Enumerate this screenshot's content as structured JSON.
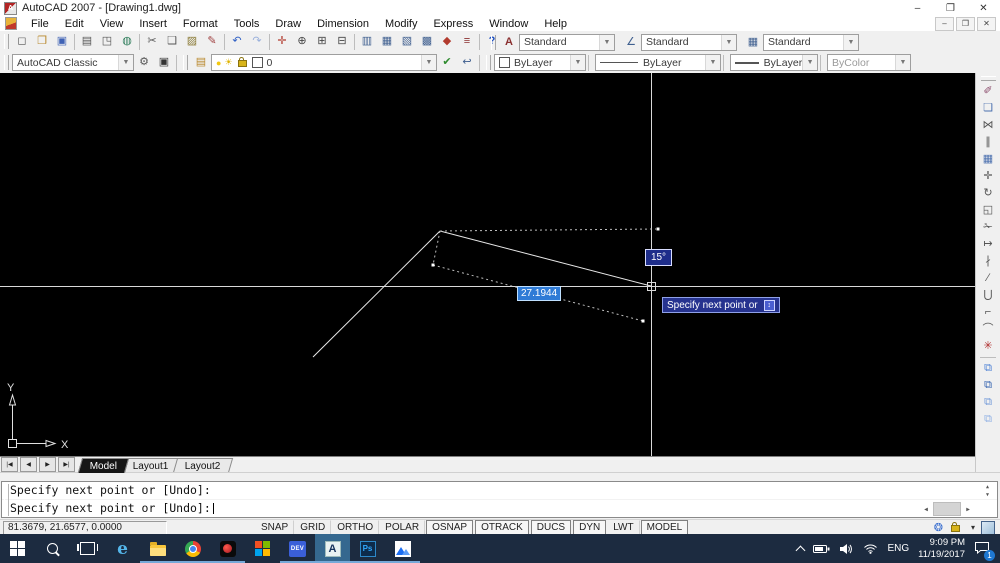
{
  "colors": {
    "taskbar_bg": "#1c2b40",
    "taskbar_active": "#35688f",
    "open_underline": "#76a9d8",
    "dyn_box_bg": "#1e2d8a",
    "selection_blue": "#2f7bd6",
    "canvas_bg": "#000000"
  },
  "window": {
    "title": "AutoCAD 2007 - [Drawing1.dwg]",
    "minimize_glyph": "–",
    "restore_glyph": "❐",
    "close_glyph": "✕"
  },
  "menubar": {
    "items": [
      {
        "n": "menu-file",
        "label": "File"
      },
      {
        "n": "menu-edit",
        "label": "Edit"
      },
      {
        "n": "menu-view",
        "label": "View"
      },
      {
        "n": "menu-insert",
        "label": "Insert"
      },
      {
        "n": "menu-format",
        "label": "Format"
      },
      {
        "n": "menu-tools",
        "label": "Tools"
      },
      {
        "n": "menu-draw",
        "label": "Draw"
      },
      {
        "n": "menu-dimension",
        "label": "Dimension"
      },
      {
        "n": "menu-modify",
        "label": "Modify"
      },
      {
        "n": "menu-express",
        "label": "Express"
      },
      {
        "n": "menu-window",
        "label": "Window"
      },
      {
        "n": "menu-help",
        "label": "Help"
      }
    ]
  },
  "toolbar1": {
    "file_group": [
      {
        "n": "qnew-button",
        "g": "◻",
        "c": "#555555"
      },
      {
        "n": "open-button",
        "g": "❐",
        "c": "#b8872b"
      },
      {
        "n": "save-button",
        "g": "▣",
        "c": "#3f62b5"
      }
    ],
    "print_group": [
      {
        "n": "plot-button",
        "g": "▤",
        "c": "#555555"
      },
      {
        "n": "plot-preview-button",
        "g": "◳",
        "c": "#555555"
      },
      {
        "n": "publish-button",
        "g": "◍",
        "c": "#2e7d5b"
      }
    ],
    "clipboard_group": [
      {
        "n": "cut-button",
        "g": "✂",
        "c": "#555555"
      },
      {
        "n": "copy-clip-button",
        "g": "❑",
        "c": "#555555"
      },
      {
        "n": "paste-button",
        "g": "▨",
        "c": "#8a7a35"
      },
      {
        "n": "match-properties-button",
        "g": "✎",
        "c": "#a04040"
      }
    ],
    "undo_group": [
      {
        "n": "undo-button",
        "g": "↶",
        "c": "#2f5fc4"
      },
      {
        "n": "redo-button",
        "g": "↷",
        "c": "#9ab0dc"
      }
    ],
    "zoom_group": [
      {
        "n": "pan-button",
        "g": "✛",
        "c": "#b23b2e"
      },
      {
        "n": "zoom-realtime-button",
        "g": "⊕",
        "c": "#444444"
      },
      {
        "n": "zoom-window-button",
        "g": "⊞",
        "c": "#444444"
      },
      {
        "n": "zoom-previous-button",
        "g": "⊟",
        "c": "#444444"
      }
    ],
    "palette_group": [
      {
        "n": "properties-palette-button",
        "g": "▥",
        "c": "#3f5f8f"
      },
      {
        "n": "designcenter-button",
        "g": "▦",
        "c": "#3f5f8f"
      },
      {
        "n": "tool-palettes-button",
        "g": "▧",
        "c": "#3f5f8f"
      },
      {
        "n": "sheet-set-manager-button",
        "g": "▩",
        "c": "#3f5f8f"
      },
      {
        "n": "markup-set-manager-button",
        "g": "◆",
        "c": "#b23b2e"
      },
      {
        "n": "quickcalc-button",
        "g": "≡",
        "c": "#8a2f2f"
      }
    ],
    "help_group": [
      {
        "n": "help-button",
        "g": "?",
        "c": "#1d4fc0"
      }
    ]
  },
  "styles_toolbar": {
    "text_style_icon": "A",
    "text_style": "Standard",
    "dim_style_icon": "∠",
    "dim_style": "Standard",
    "table_style_icon": "▦",
    "table_style": "Standard"
  },
  "workspaces_toolbar": {
    "value": "AutoCAD Classic",
    "gear_glyph": "⚙",
    "myws_glyph": "▣"
  },
  "layers_toolbar": {
    "manager_glyph": "▤",
    "bulb_glyph": "●",
    "freeze_glyph": "☀",
    "layer_name": "0",
    "make_current_glyph": "✔",
    "layer_previous_glyph": "↩"
  },
  "properties_toolbar": {
    "color": "ByLayer",
    "linetype": "ByLayer",
    "lineweight": "ByLayer",
    "plot_style": "ByColor"
  },
  "modify_toolbar": {
    "buttons": [
      {
        "n": "erase-button",
        "g": "✐",
        "c": "#8a4a6a"
      },
      {
        "n": "copy-button",
        "g": "❏",
        "c": "#4a6fae"
      },
      {
        "n": "mirror-button",
        "g": "⋈",
        "c": "#555555"
      },
      {
        "n": "offset-button",
        "g": "∥",
        "c": "#555555"
      },
      {
        "n": "array-button",
        "g": "▦",
        "c": "#4a6fae"
      },
      {
        "n": "move-button",
        "g": "✛",
        "c": "#555555"
      },
      {
        "n": "rotate-button",
        "g": "↻",
        "c": "#555555"
      },
      {
        "n": "scale-button",
        "g": "◱",
        "c": "#555555"
      },
      {
        "n": "trim-button",
        "g": "✁",
        "c": "#555555"
      },
      {
        "n": "extend-button",
        "g": "↦",
        "c": "#555555"
      },
      {
        "n": "break-at-point-button",
        "g": "∤",
        "c": "#555555"
      },
      {
        "n": "break-button",
        "g": "∕",
        "c": "#555555"
      },
      {
        "n": "join-button",
        "g": "⋃",
        "c": "#555555"
      },
      {
        "n": "chamfer-button",
        "g": "⌐",
        "c": "#555555"
      },
      {
        "n": "fillet-button",
        "g": "⌒",
        "c": "#555555"
      },
      {
        "n": "explode-button",
        "g": "✳",
        "c": "#b03030"
      }
    ]
  },
  "draworder_toolbar": {
    "buttons": [
      {
        "n": "draworder-bring-to-front-button",
        "g": "⧉",
        "c": "#4a7fd4"
      },
      {
        "n": "draworder-send-to-back-button",
        "g": "⧉",
        "c": "#2f5fae"
      },
      {
        "n": "draworder-bring-above-button",
        "g": "⧉",
        "c": "#6f97d8"
      },
      {
        "n": "draworder-send-under-button",
        "g": "⧉",
        "c": "#8fb0e4"
      }
    ]
  },
  "canvas": {
    "distance_value": "27.1944",
    "angle_value": "15°",
    "tooltip_text": "Specify next point or",
    "tooltip_key_glyph": "↕",
    "ucs": {
      "x_label": "X",
      "y_label": "Y"
    }
  },
  "tabs": {
    "nav": [
      "|◀",
      "◀",
      "▶",
      "▶|"
    ],
    "items": [
      {
        "n": "tab-model",
        "label": "Model",
        "active": true
      },
      {
        "n": "tab-layout1",
        "label": "Layout1",
        "active": false
      },
      {
        "n": "tab-layout2",
        "label": "Layout2",
        "active": false
      }
    ]
  },
  "command": {
    "line1": "Specify next point or [Undo]:",
    "line2": "Specify next point or [Undo]:"
  },
  "statusbar": {
    "coords": "81.3679, 21.6577, 0.0000",
    "toggles": [
      {
        "n": "toggle-snap",
        "label": "SNAP",
        "active": false
      },
      {
        "n": "toggle-grid",
        "label": "GRID",
        "active": false
      },
      {
        "n": "toggle-ortho",
        "label": "ORTHO",
        "active": false
      },
      {
        "n": "toggle-polar",
        "label": "POLAR",
        "active": false
      },
      {
        "n": "toggle-osnap",
        "label": "OSNAP",
        "active": true
      },
      {
        "n": "toggle-otrack",
        "label": "OTRACK",
        "active": true
      },
      {
        "n": "toggle-ducs",
        "label": "DUCS",
        "active": true
      },
      {
        "n": "toggle-dyn",
        "label": "DYN",
        "active": true
      },
      {
        "n": "toggle-lwt",
        "label": "LWT",
        "active": false
      },
      {
        "n": "toggle-model",
        "label": "MODEL",
        "active": true
      }
    ],
    "arrow_glyph": "▾"
  },
  "taskbar": {
    "edge_letter": "e",
    "dev_label": "DEV",
    "autocad_label": "A",
    "ps_label": "Ps",
    "tray": {
      "lang": "ENG",
      "time": "9:09 PM",
      "date": "11/19/2017",
      "notification_count": "1"
    }
  }
}
